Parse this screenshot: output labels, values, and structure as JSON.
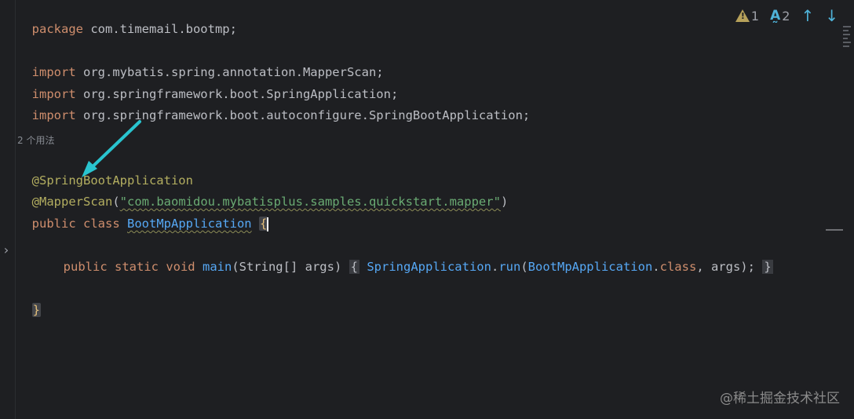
{
  "editor": {
    "lines": {
      "l1": {
        "kw": "package",
        "rest": " com.timemail.bootmp;"
      },
      "l3": {
        "kw": "import",
        "rest": " org.mybatis.spring.annotation.MapperScan;"
      },
      "l4": {
        "kw": "import",
        "rest": " org.springframework.boot.SpringApplication;"
      },
      "l5": {
        "kw": "import",
        "rest": " org.springframework.boot.autoconfigure.SpringBootApplication;"
      },
      "usage": "2 个用法",
      "l7": {
        "ann": "@SpringBootApplication"
      },
      "l8": {
        "ann": "@MapperScan",
        "open": "(",
        "str": "\"com.baomidou.mybatisplus.samples.quickstart.mapper\"",
        "close": ")"
      },
      "l9": {
        "kw": "public class ",
        "cls": "BootMpApplication",
        "sp": " ",
        "brace": "{"
      },
      "l11": {
        "kw": "public static void ",
        "method": "main",
        "params": "(String[] args)",
        "fold_open": "{",
        "body_cls": "SpringApplication",
        "body_dot": ".",
        "body_method": "run",
        "body_open": "(",
        "body_cls2": "BootMpApplication",
        "body_dot2": ".",
        "body_kw": "class",
        "body_rest": ", args);",
        "fold_close": "}"
      },
      "l13": {
        "brace": "}"
      }
    }
  },
  "toolbar": {
    "warnings_count": "1",
    "spelling_count": "2",
    "prev_label": "↑",
    "next_label": "↓"
  },
  "watermark": "@稀土掘金技术社区"
}
